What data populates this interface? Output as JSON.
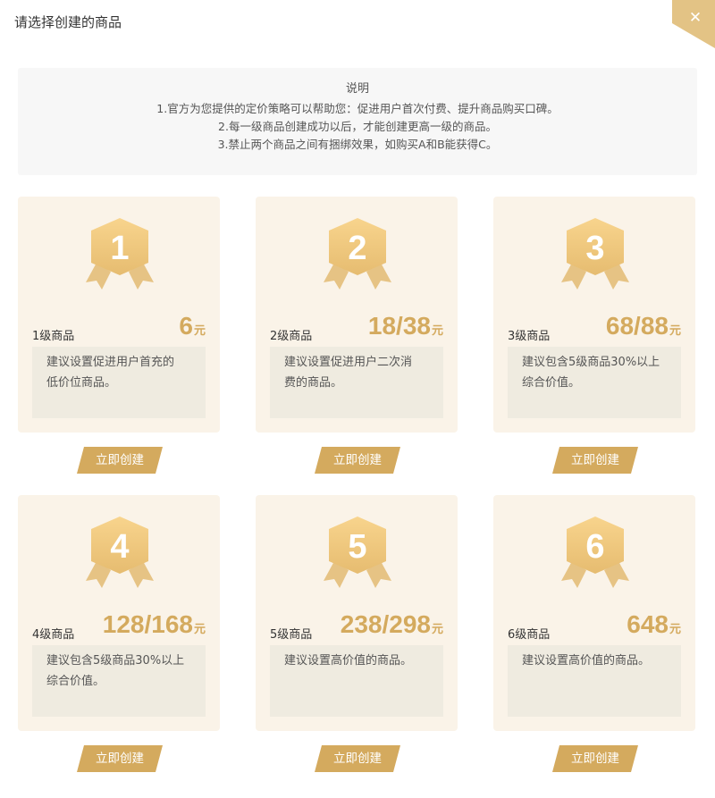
{
  "dialog": {
    "title": "请选择创建的商品",
    "close_symbol": "✕",
    "close_icon": "close-icon"
  },
  "info": {
    "heading": "说明",
    "lines": [
      "1.官方为您提供的定价策略可以帮助您：促进用户首次付费、提升商品购买口碑。",
      "2.每一级商品创建成功以后，才能创建更高一级的商品。",
      "3.禁止两个商品之间有捆绑效果，如购买A和B能获得C。"
    ]
  },
  "colors": {
    "accent": "#d4aa5e",
    "card_bg": "#faf3e8",
    "desc_bg": "#efebe0",
    "info_bg": "#f7f7f7",
    "badge_top": "#f8d48d",
    "badge_bottom": "#e6bc70"
  },
  "cards": [
    {
      "level": "1",
      "label": "1级商品",
      "price": "6",
      "unit": "元",
      "desc": [
        "建议设置促进用户首充的",
        "低价位商品。"
      ],
      "button": "立即创建",
      "icon": "medal-icon"
    },
    {
      "level": "2",
      "label": "2级商品",
      "price": "18/38",
      "unit": "元",
      "desc": [
        "建议设置促进用户二次消",
        "费的商品。"
      ],
      "button": "立即创建",
      "icon": "medal-icon"
    },
    {
      "level": "3",
      "label": "3级商品",
      "price": "68/88",
      "unit": "元",
      "desc": [
        "建议包含5级商品30%以上",
        "综合价值。"
      ],
      "button": "立即创建",
      "icon": "medal-icon"
    },
    {
      "level": "4",
      "label": "4级商品",
      "price": "128/168",
      "unit": "元",
      "desc": [
        "建议包含5级商品30%以上",
        "综合价值。"
      ],
      "button": "立即创建",
      "icon": "medal-icon"
    },
    {
      "level": "5",
      "label": "5级商品",
      "price": "238/298",
      "unit": "元",
      "desc": [
        "建议设置高价值的商品。"
      ],
      "button": "立即创建",
      "icon": "medal-icon"
    },
    {
      "level": "6",
      "label": "6级商品",
      "price": "648",
      "unit": "元",
      "desc": [
        "建议设置高价值的商品。"
      ],
      "button": "立即创建",
      "icon": "medal-icon"
    }
  ]
}
